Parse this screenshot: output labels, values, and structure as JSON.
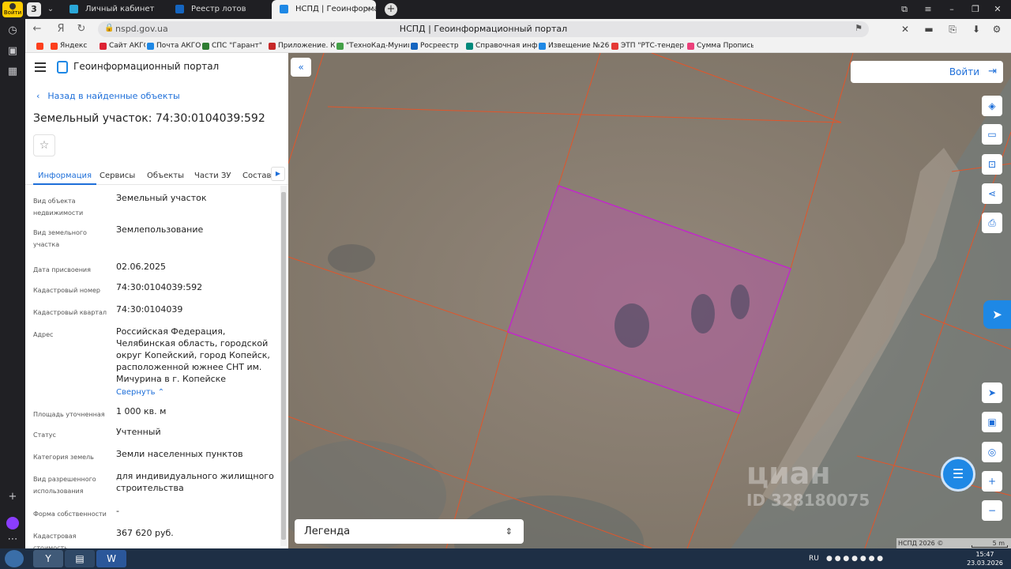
{
  "browser": {
    "tab_count": "3",
    "tabs": [
      {
        "label": "Личный кабинет"
      },
      {
        "label": "Реестр лотов"
      },
      {
        "label": "НСПД | Геоинформационный портал"
      }
    ],
    "login_badge": "Войти",
    "address_host": "nspd.gov.ua",
    "page_title": "НСПД | Геоинформационный портал",
    "bookmarks": [
      {
        "label": "Яндекс",
        "color": "#fc3f1d"
      },
      {
        "label": "Сайт АКГО",
        "color": "#d23"
      },
      {
        "label": "Почта АКГО",
        "color": "#1e88e5"
      },
      {
        "label": "СПС \"Гарант\"",
        "color": "#2e7d32"
      },
      {
        "label": "Приложение. Кла",
        "color": "#c62828"
      },
      {
        "label": "\"ТехноКад-Муниц",
        "color": "#43a047"
      },
      {
        "label": "Росреестр",
        "color": "#1565c0"
      },
      {
        "label": "Справочная инфо",
        "color": "#00897b"
      },
      {
        "label": "Извещение №26",
        "color": "#1e88e5"
      },
      {
        "label": "ЭТП \"РТС-тендер",
        "color": "#e53935"
      },
      {
        "label": "Сумма Прописью",
        "color": "#ec407a"
      }
    ]
  },
  "panel": {
    "portal_title": "Геоинформационный портал",
    "back_link": "Назад в найденные объекты",
    "object_title": "Земельный участок: 74:30:0104039:592",
    "tabs": [
      {
        "label": "Информация",
        "active": true
      },
      {
        "label": "Сервисы"
      },
      {
        "label": "Объекты"
      },
      {
        "label": "Части ЗУ"
      },
      {
        "label": "Состав"
      }
    ],
    "fields": [
      {
        "label": "Вид объекта недвижимости",
        "value": "Земельный участок"
      },
      {
        "label": "Вид земельного участка",
        "value": "Землепользование"
      },
      {
        "label": "Дата присвоения",
        "value": "02.06.2025"
      },
      {
        "label": "Кадастровый номер",
        "value": "74:30:0104039:592"
      },
      {
        "label": "Кадастровый квартал",
        "value": "74:30:0104039"
      },
      {
        "label": "Адрес",
        "value": "Российская Федерация, Челябинская область, городской округ Копейский, город Копейск, расположенной южнее СНТ им. Мичурина в г. Копейске"
      },
      {
        "label": "Площадь уточненная",
        "value": "1 000 кв. м"
      },
      {
        "label": "Статус",
        "value": "Учтенный"
      },
      {
        "label": "Категория земель",
        "value": "Земли населенных пунктов"
      },
      {
        "label": "Вид разрешенного использования",
        "value": "для индивидуального жилищного строительства"
      },
      {
        "label": "Форма собственности",
        "value": "-"
      },
      {
        "label": "Кадастровая стоимость",
        "value": "367 620 руб."
      }
    ],
    "collapse_link": "Свернуть"
  },
  "map": {
    "login_label": "Войти",
    "legend_label": "Легенда",
    "copyright": "НСПД 2026 ©",
    "scale_label": "5 m",
    "watermark_brand": "циан",
    "watermark_id": "ID 328180075",
    "colors": {
      "parcel_fill": "#b05aa0",
      "parcel_stroke": "#c02ac8",
      "boundary": "#e2552a"
    }
  },
  "taskbar": {
    "lang": "RU",
    "time": "15:47",
    "date": "23.03.2026"
  }
}
